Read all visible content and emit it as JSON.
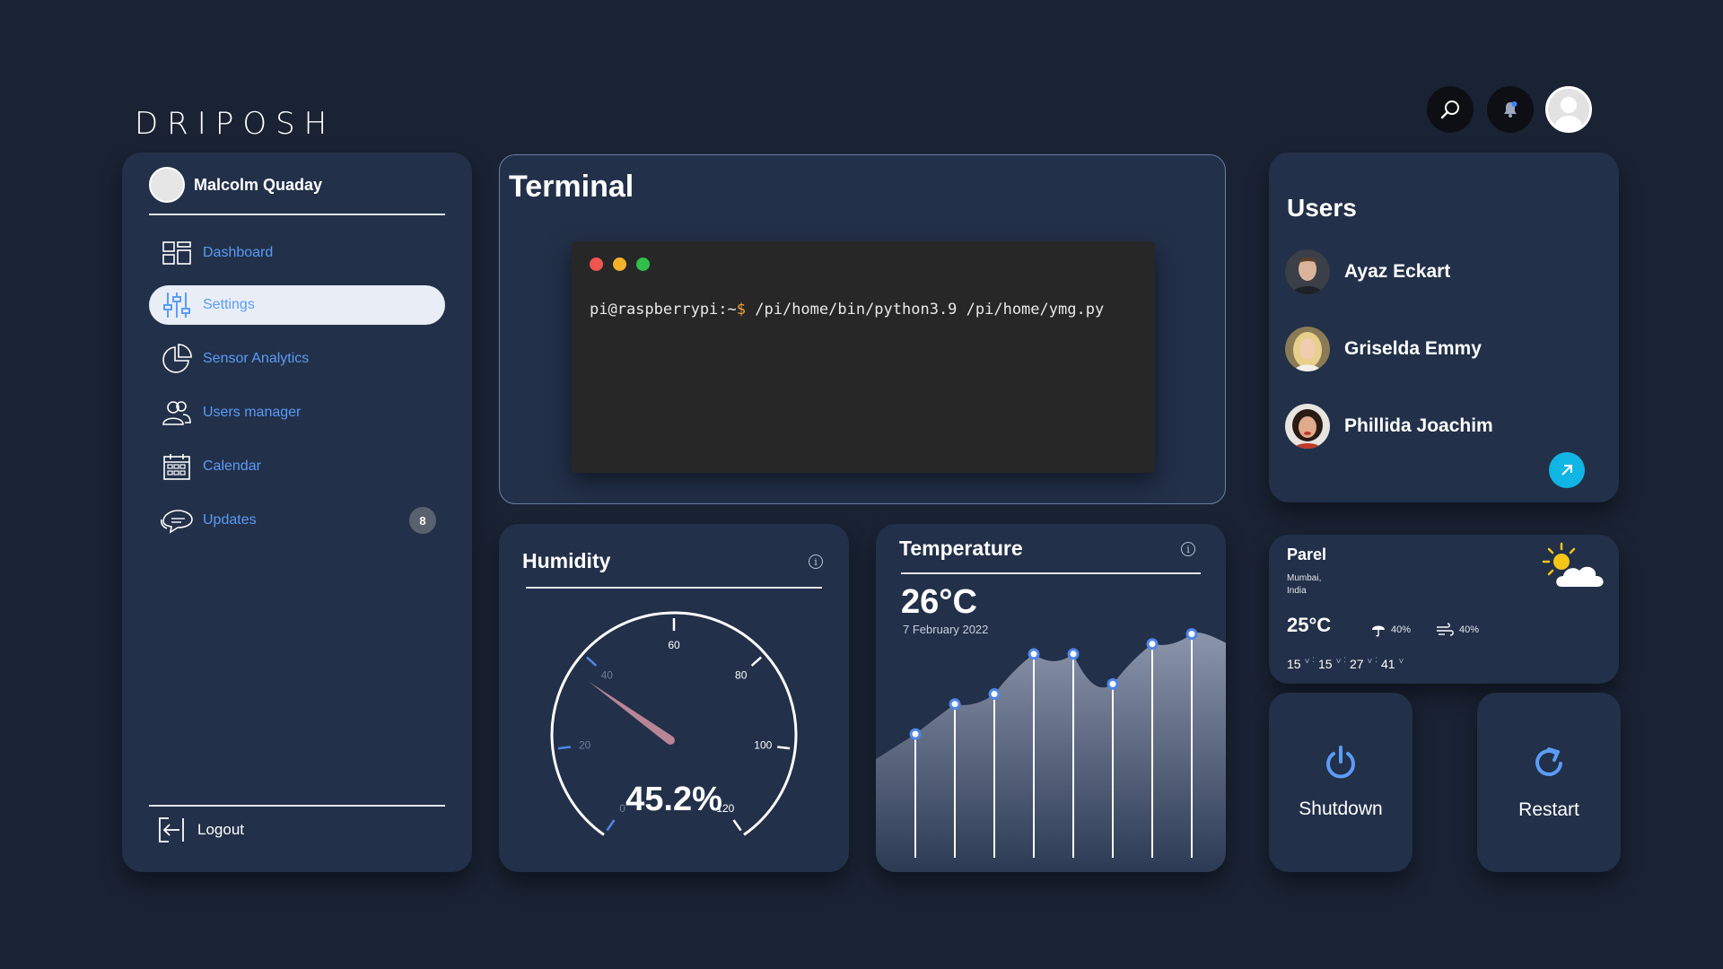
{
  "brand": {
    "logo_text": "DRIPOSH"
  },
  "topbar": {
    "search_icon": "search-icon",
    "bell_icon": "bell-icon"
  },
  "sidebar": {
    "user_name": "Malcolm Quaday",
    "items": [
      {
        "label": "Dashboard",
        "icon": "dashboard-icon"
      },
      {
        "label": "Settings",
        "icon": "sliders-icon",
        "active": true
      },
      {
        "label": "Sensor Analytics",
        "icon": "pie-chart-icon"
      },
      {
        "label": "Users manager",
        "icon": "users-icon"
      },
      {
        "label": "Calendar",
        "icon": "calendar-icon"
      },
      {
        "label": "Updates",
        "icon": "chat-icon",
        "badge": "8"
      }
    ],
    "logout_label": "Logout"
  },
  "terminal": {
    "title": "Terminal",
    "prompt": "pi@raspberrypi:~",
    "prompt_symbol": "$",
    "command": " /pi/home/bin/python3.9 /pi/home/ymg.py"
  },
  "users": {
    "title": "Users",
    "list": [
      {
        "name": "Ayaz Eckart"
      },
      {
        "name": "Griselda Emmy"
      },
      {
        "name": "Phillida Joachim"
      }
    ]
  },
  "humidity": {
    "title": "Humidity",
    "value_label": "45.2%",
    "value": 45.2,
    "gauge_ticks": [
      "0",
      "20",
      "40",
      "60",
      "80",
      "100",
      "120"
    ]
  },
  "temperature": {
    "title": "Temperature",
    "value": "26°C",
    "date": "7 February 2022",
    "chart_data": {
      "type": "area",
      "values": [
        12,
        15,
        16,
        20,
        20,
        17,
        21,
        22
      ]
    }
  },
  "weather": {
    "city": "Parel",
    "region_line1": "Mumbai,",
    "region_line2": "India",
    "temp": "25°C",
    "rain": "40%",
    "wind": "40%",
    "forecast": [
      "15",
      "15",
      "27",
      "41"
    ]
  },
  "actions": {
    "shutdown_label": "Shutdown",
    "restart_label": "Restart"
  },
  "colors": {
    "background": "#1a2334",
    "card": "#223049",
    "accent": "#5b9cf7",
    "fab": "#11b5e4"
  }
}
